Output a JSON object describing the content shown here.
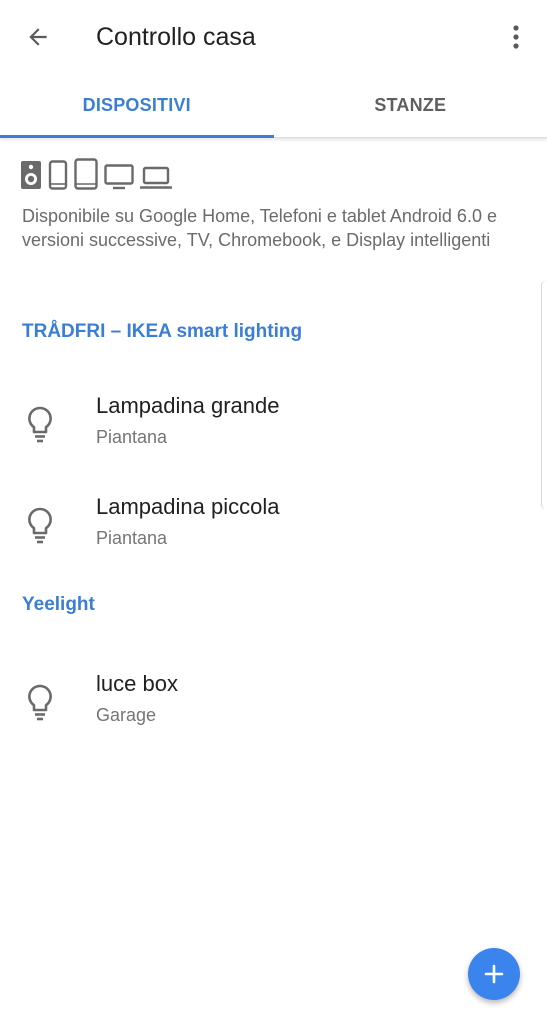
{
  "appbar": {
    "title": "Controllo casa",
    "back_icon": "arrow-back-icon",
    "menu_icon": "more-vert-icon"
  },
  "tabs": [
    {
      "label": "DISPOSITIVI",
      "active": true
    },
    {
      "label": "STANZE",
      "active": false
    }
  ],
  "device_icons": [
    "speaker-icon",
    "phone-icon",
    "tablet-icon",
    "tv-icon",
    "laptop-icon"
  ],
  "availability_text": "Disponibile su Google Home, Telefoni e tablet Android 6.0 e versioni successive, TV, Chromebook, e Display intelligenti",
  "sections": [
    {
      "header": "TRÅDFRI – IKEA smart lighting",
      "devices": [
        {
          "name": "Lampadina grande",
          "room": "Piantana",
          "icon": "lightbulb-icon"
        },
        {
          "name": "Lampadina piccola",
          "room": "Piantana",
          "icon": "lightbulb-icon"
        }
      ]
    },
    {
      "header": "Yeelight",
      "devices": [
        {
          "name": "luce box",
          "room": "Garage",
          "icon": "lightbulb-icon"
        }
      ]
    }
  ],
  "fab": {
    "icon": "add-icon"
  },
  "colors": {
    "accent": "#3b7ed6",
    "fab": "#3b84ee",
    "text_primary": "#212121",
    "text_secondary": "#757575"
  }
}
